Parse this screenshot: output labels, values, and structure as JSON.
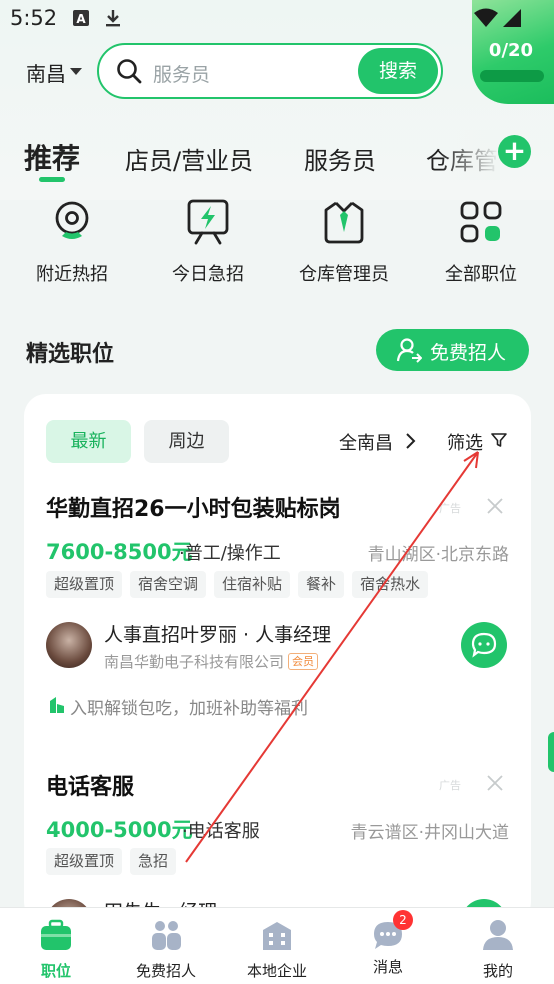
{
  "status_bar": {
    "time": "5:52"
  },
  "quota": {
    "count": "0/20"
  },
  "header": {
    "city": "南昌",
    "search_placeholder": "服务员",
    "search_button": "搜索"
  },
  "tabs": [
    {
      "label": "推荐",
      "active": true
    },
    {
      "label": "店员/营业员"
    },
    {
      "label": "服务员"
    },
    {
      "label": "仓库管"
    }
  ],
  "categories": [
    {
      "label": "附近热招",
      "icon": "location-pin-icon"
    },
    {
      "label": "今日急招",
      "icon": "lightning-board-icon"
    },
    {
      "label": "仓库管理员",
      "icon": "shirt-tie-icon"
    },
    {
      "label": "全部职位",
      "icon": "grid-icon"
    }
  ],
  "section": {
    "title": "精选职位",
    "hire_button": "免费招人"
  },
  "filters": {
    "chips": [
      "最新",
      "周边"
    ],
    "region": "全南昌",
    "filter_label": "筛选"
  },
  "jobs": [
    {
      "title": "华勤直招26一小时包装贴标岗",
      "ad": "广告",
      "salary": "7600-8500元",
      "role": "·普工/操作工",
      "location": "青山湖区·北京东路",
      "tags": [
        "超级置顶",
        "宿舍空调",
        "住宿补贴",
        "餐补",
        "宿舍热水"
      ],
      "recruiter": "人事直招叶罗丽 · 人事经理",
      "company": "南昌华勤电子科技有限公司",
      "company_badge": "会员",
      "benefit": "入职解锁包吃，加班补助等福利"
    },
    {
      "title": "电话客服",
      "ad": "广告",
      "salary": "4000-5000元",
      "role": "·电话客服",
      "location": "青云谱区·井冈山大道",
      "tags": [
        "超级置顶",
        "急招"
      ],
      "recruiter": "田先生 · 经理"
    }
  ],
  "bottom_nav": [
    {
      "label": "职位",
      "icon": "briefcase-icon",
      "active": true
    },
    {
      "label": "免费招人",
      "icon": "people-icon"
    },
    {
      "label": "本地企业",
      "icon": "building-icon"
    },
    {
      "label": "消息",
      "icon": "chat-icon",
      "badge": "2"
    },
    {
      "label": "我的",
      "icon": "user-icon"
    }
  ],
  "colors": {
    "accent": "#22c46b",
    "badge": "#ff3333"
  }
}
